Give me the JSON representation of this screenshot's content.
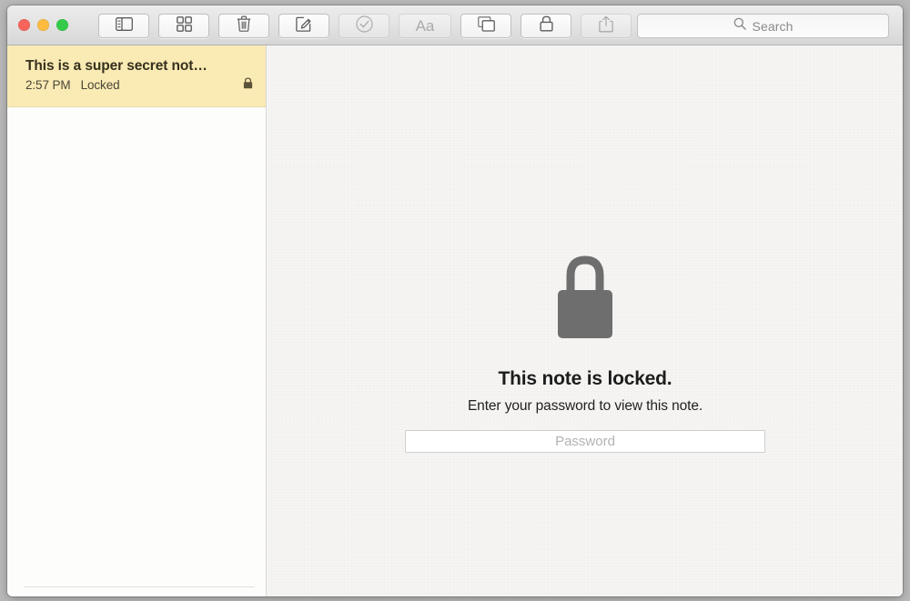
{
  "window": {
    "traffic_lights": [
      {
        "name": "close",
        "color": "#f7645c"
      },
      {
        "name": "minimize",
        "color": "#fdbc40"
      },
      {
        "name": "zoom",
        "color": "#34cb4b"
      }
    ]
  },
  "toolbar": {
    "buttons": [
      {
        "icon": "sidebar-toggle-icon",
        "label": "Sidebar",
        "enabled": true
      },
      {
        "icon": "grid-attachments-icon",
        "label": "Attachments",
        "enabled": true
      },
      {
        "icon": "trash-icon",
        "label": "Delete",
        "enabled": true
      },
      {
        "icon": "compose-icon",
        "label": "New Note",
        "enabled": true
      },
      {
        "icon": "checklist-icon",
        "label": "Checklist",
        "enabled": false
      },
      {
        "icon": "format-text-icon",
        "label": "Aa",
        "enabled": false
      },
      {
        "icon": "new-window-icon",
        "label": "New Window",
        "enabled": true
      },
      {
        "icon": "lock-icon",
        "label": "Lock",
        "enabled": true
      },
      {
        "icon": "share-icon",
        "label": "Share",
        "enabled": false
      }
    ],
    "format_button_text": "Aa"
  },
  "search": {
    "icon": "search-icon",
    "placeholder": "Search",
    "value": ""
  },
  "sidebar": {
    "notes": [
      {
        "title": "This is a super secret not…",
        "time": "2:57 PM",
        "status": "Locked",
        "lock_icon": "lock-small-icon",
        "selected": true
      }
    ]
  },
  "content": {
    "lock_icon": "big-lock-icon",
    "title": "This note is locked.",
    "subtitle": "Enter your password to view this note.",
    "password": {
      "placeholder": "Password",
      "value": ""
    }
  },
  "colors": {
    "selection": "#faeab4",
    "titlebar_top": "#ececec",
    "titlebar_bottom": "#d6d6d6",
    "lock_gray": "#6e6e6e",
    "paper": "#f6f5f3"
  }
}
